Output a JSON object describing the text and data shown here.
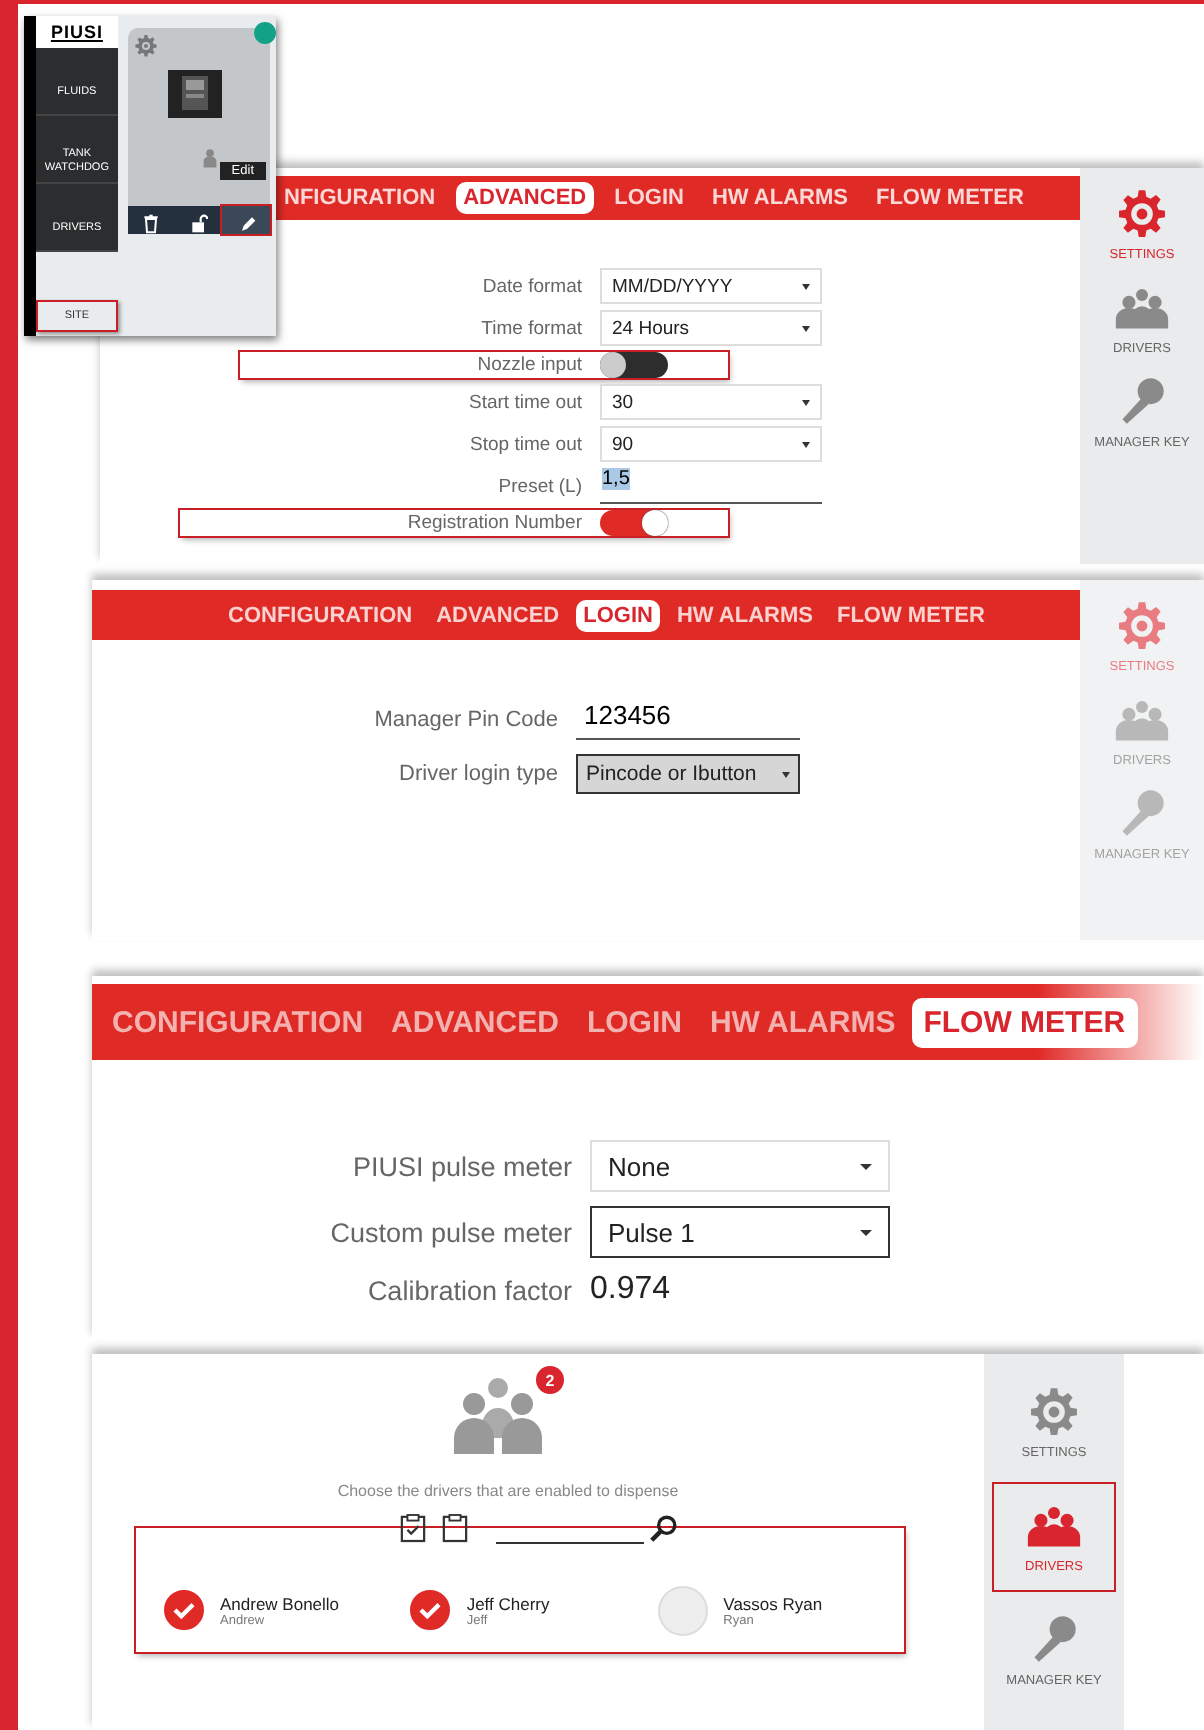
{
  "site_panel": {
    "logo": "PIUSI",
    "menu": [
      {
        "label": "FLUIDS",
        "highlighted": false
      },
      {
        "label": "TANK WATCHDOG",
        "highlighted": false
      },
      {
        "label": "DRIVERS",
        "highlighted": false
      },
      {
        "label": "SITE",
        "highlighted": true
      }
    ],
    "device_card": {
      "online": true,
      "tooltip": "Edit",
      "tools": [
        {
          "kind": "trash",
          "highlighted": false
        },
        {
          "kind": "lock",
          "highlighted": false
        },
        {
          "kind": "pen",
          "highlighted": true
        }
      ]
    }
  },
  "panels": [
    {
      "kind": "advanced",
      "tabs": [
        {
          "label": "NFIGURATION",
          "selected": false
        },
        {
          "label": "ADVANCED",
          "selected": true
        },
        {
          "label": "LOGIN",
          "selected": false
        },
        {
          "label": "HW ALARMS",
          "selected": false
        },
        {
          "label": "FLOW METER",
          "selected": false
        }
      ],
      "rows": [
        {
          "kind": "select",
          "label": "Date format",
          "value": "MM/DD/YYYY",
          "focused": false,
          "highlighted": false
        },
        {
          "kind": "select",
          "label": "Time format",
          "value": "24 Hours",
          "focused": false,
          "highlighted": false
        },
        {
          "kind": "toggle",
          "label": "Nozzle input",
          "on": false,
          "highlighted": true
        },
        {
          "kind": "select",
          "label": "Start time out",
          "value": "30",
          "focused": false,
          "highlighted": false
        },
        {
          "kind": "select",
          "label": "Stop time out",
          "value": "90",
          "focused": false,
          "highlighted": false
        },
        {
          "kind": "text",
          "label": "Preset (L)",
          "value": "1,5",
          "highlighted": false
        },
        {
          "kind": "toggle",
          "label": "Registration Number",
          "on": true,
          "highlighted": true
        }
      ],
      "side": [
        {
          "label": "SETTINGS",
          "selected": true,
          "highlighted": false
        },
        {
          "label": "DRIVERS",
          "selected": false,
          "highlighted": false
        },
        {
          "label": "MANAGER KEY",
          "selected": false,
          "highlighted": false
        }
      ]
    },
    {
      "kind": "login",
      "tabs": [
        {
          "label": "CONFIGURATION",
          "selected": false
        },
        {
          "label": "ADVANCED",
          "selected": false
        },
        {
          "label": "LOGIN",
          "selected": true
        },
        {
          "label": "HW ALARMS",
          "selected": false
        },
        {
          "label": "FLOW METER",
          "selected": false
        }
      ],
      "rows": [
        {
          "kind": "text",
          "label": "Manager Pin Code",
          "value": "123456",
          "highlighted": false
        },
        {
          "kind": "select",
          "label": "Driver login type",
          "value": "Pincode or Ibutton",
          "focused": true,
          "highlighted": false
        }
      ],
      "side": [
        {
          "label": "SETTINGS",
          "selected": true,
          "highlighted": false
        },
        {
          "label": "DRIVERS",
          "selected": false,
          "highlighted": false
        },
        {
          "label": "MANAGER KEY",
          "selected": false,
          "highlighted": false
        }
      ]
    },
    {
      "kind": "flow",
      "tabs": [
        {
          "label": "CONFIGURATION",
          "selected": false
        },
        {
          "label": "ADVANCED",
          "selected": false
        },
        {
          "label": "LOGIN",
          "selected": false
        },
        {
          "label": "HW ALARMS",
          "selected": false
        },
        {
          "label": "FLOW METER",
          "selected": true
        }
      ],
      "rows": [
        {
          "kind": "select",
          "label": "PIUSI pulse meter",
          "value": "None",
          "focused": false,
          "highlighted": false
        },
        {
          "kind": "select",
          "label": "Custom pulse meter",
          "value": "Pulse 1",
          "focused": true,
          "highlighted": false
        },
        {
          "kind": "value",
          "label": "Calibration factor",
          "value": "0.974",
          "highlighted": false
        }
      ]
    },
    {
      "kind": "drivers",
      "badge": "2",
      "caption": "Choose the drivers that are enabled to dispense",
      "list_highlighted": true,
      "drivers": [
        {
          "name": "Andrew Bonello",
          "login": "Andrew",
          "selected": true
        },
        {
          "name": "Jeff Cherry",
          "login": "Jeff",
          "selected": true
        },
        {
          "name": "Vassos Ryan",
          "login": "Ryan",
          "selected": false
        }
      ],
      "side": [
        {
          "label": "SETTINGS",
          "selected": false,
          "highlighted": false
        },
        {
          "label": "DRIVERS",
          "selected": true,
          "highlighted": true
        },
        {
          "label": "MANAGER KEY",
          "selected": false,
          "highlighted": false
        }
      ]
    }
  ]
}
